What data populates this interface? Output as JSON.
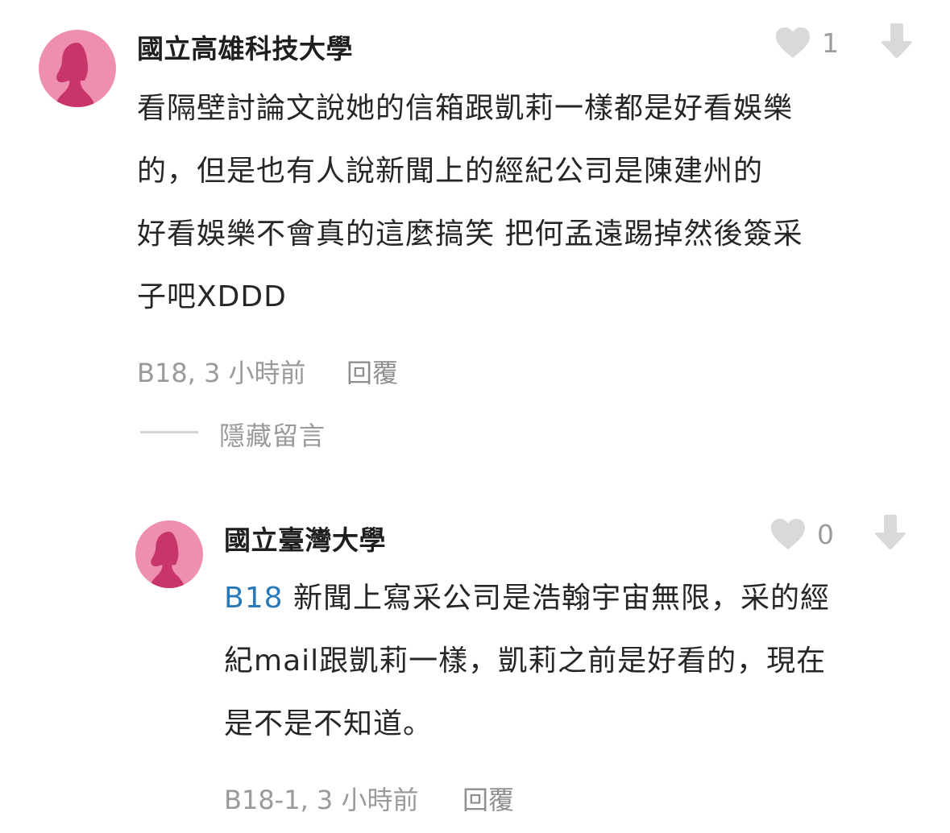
{
  "comments": [
    {
      "author": "國立高雄科技大學",
      "likes": "1",
      "lines": [
        "看隔壁討論文說她的信箱跟凱莉一樣都是好看娛樂",
        "的，但是也有人說新聞上的經紀公司是陳建州的",
        "好看娛樂不會真的這麼搞笑 把何孟遠踢掉然後簽采",
        "子吧XDDD"
      ],
      "meta": "B18, 3 小時前",
      "reply_label": "回覆",
      "hide_label": "隱藏留言"
    },
    {
      "author": "國立臺灣大學",
      "likes": "0",
      "ref": "B18",
      "lines": [
        " 新聞上寫采公司是浩翰宇宙無限，采的經",
        "紀mail跟凱莉一樣，凱莉之前是好看的，現在",
        "是不是不知道。"
      ],
      "meta": "B18-1, 3 小時前",
      "reply_label": "回覆"
    }
  ],
  "colors": {
    "avatar_bg": "#ef8fb0",
    "avatar_figure": "#c8356b",
    "ref_link": "#2a7ab7",
    "icon_gray": "#d9d9d9"
  },
  "icons": [
    "heart-icon",
    "arrow-down-icon",
    "avatar-silhouette-icon"
  ]
}
